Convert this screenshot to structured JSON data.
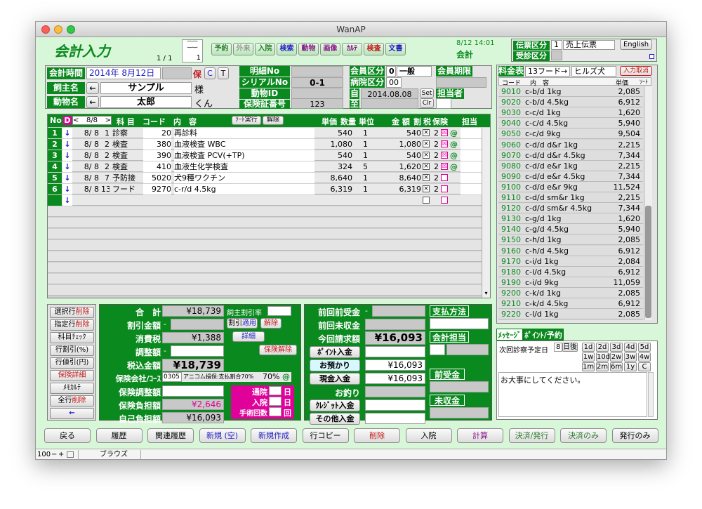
{
  "window": {
    "title": "WanAP"
  },
  "header": {
    "title": "会計入力",
    "page": "1 / 1",
    "counter": "1",
    "tabs": [
      {
        "label": "予約",
        "color": "#2a7a2a"
      },
      {
        "label": "外来",
        "color": "#999999"
      },
      {
        "label": "入院",
        "color": "#2a7a2a"
      },
      {
        "label": "検索",
        "color": "#2020c0"
      },
      {
        "label": "動物",
        "color": "#8a1a8a"
      },
      {
        "label": "画像",
        "color": "#8a1a8a"
      },
      {
        "label": "ｶﾙﾃ",
        "color": "#8a1a8a"
      },
      {
        "label": "検査",
        "color": "#c01a1a"
      },
      {
        "label": "文書",
        "color": "#2020c0"
      }
    ],
    "datetime": "8/12 14:01",
    "mode": "会計",
    "slip_label": "伝票区分",
    "slip_num": "1",
    "slip_value": "売上伝票",
    "reception_label": "受診区分",
    "english_button": "English"
  },
  "info": {
    "time_label": "会計時間",
    "date": "2014年 8月12日",
    "badge_ho": "保",
    "badge_c": "C",
    "badge_t": "T",
    "owner_label": "飼主名",
    "owner_arrow": "←",
    "owner_name": "サンプル",
    "owner_suffix": "様",
    "pet_label": "動物名",
    "pet_arrow": "←",
    "pet_name": "太郎",
    "pet_suffix": "くん",
    "detail_no_label": "明細No",
    "serial_label": "シリアルNo",
    "serial_value": "0-1",
    "animal_id_label": "動物ID",
    "insurance_no_label": "保険証番号",
    "insurance_no": "123",
    "member_label": "会員区分",
    "member_num": "0",
    "member_value": "一般",
    "member_expiry_label": "会員期限",
    "hospital_label": "病院区分",
    "hospital_value": "00",
    "from_label": "自",
    "from_date": "2014.08.08",
    "set_button": "Set",
    "to_label": "至",
    "clr_button": "Clr",
    "staff_label": "担当者"
  },
  "detail_table": {
    "headers": {
      "no": "No",
      "d": "D",
      "date_nav": "8/8",
      "subject": "科 目",
      "code": "コード",
      "content": "内　容",
      "sort_button": "ｿｰﾄ実行",
      "cancel_button": "解除",
      "unit_price": "単価",
      "qty": "数量",
      "unit": "単位",
      "amount": "金 額",
      "discount": "割",
      "tax": "税",
      "insurance": "保険",
      "person": "担当"
    },
    "rows": [
      {
        "no": "1",
        "date": "8/ 8",
        "subj_no": "1",
        "subject": "診察",
        "code": "20",
        "content": "再診料",
        "price": "540",
        "qty": "1",
        "amount": "540",
        "tax": "2",
        "ins": "☒",
        "at": "@"
      },
      {
        "no": "2",
        "date": "8/ 8",
        "subj_no": "2",
        "subject": "検査",
        "code": "380",
        "content": "血液検査 WBC",
        "price": "1,080",
        "qty": "1",
        "amount": "1,080",
        "tax": "2",
        "ins": "☒",
        "at": "@"
      },
      {
        "no": "3",
        "date": "8/ 8",
        "subj_no": "2",
        "subject": "検査",
        "code": "390",
        "content": "血液検査 PCV(+TP)",
        "price": "540",
        "qty": "1",
        "amount": "540",
        "tax": "2",
        "ins": "☒",
        "at": "@"
      },
      {
        "no": "4",
        "date": "8/ 8",
        "subj_no": "2",
        "subject": "検査",
        "code": "410",
        "content": "血液生化学検査",
        "price": "324",
        "qty": "5",
        "amount": "1,620",
        "tax": "2",
        "ins": "☒",
        "at": "@"
      },
      {
        "no": "5",
        "date": "8/ 8",
        "subj_no": "7",
        "subject": "予防接",
        "code": "5020",
        "content": "犬9種ワクチン",
        "price": "8,640",
        "qty": "1",
        "amount": "8,640",
        "tax": "2",
        "ins": "",
        "at": ""
      },
      {
        "no": "6",
        "date": "8/ 8",
        "subj_no": "13",
        "subject": "フード",
        "code": "9270",
        "content": "c-r/d 4.5kg",
        "price": "6,319",
        "qty": "1",
        "amount": "6,319",
        "tax": "2",
        "ins": "",
        "at": ""
      }
    ],
    "down_arrow": "↓"
  },
  "price_table": {
    "label": "料金表",
    "selector": "13フード→",
    "category": "ヒルズ犬",
    "cancel_input": "入力取消",
    "headers": {
      "code": "コード",
      "content": "内　容",
      "price": "単価",
      "sort": "ｿｰﾄ"
    },
    "rows": [
      {
        "code": "9010",
        "content": "c-b/d 1kg",
        "price": "2,085"
      },
      {
        "code": "9020",
        "content": "c-b/d 4.5kg",
        "price": "6,912"
      },
      {
        "code": "9030",
        "content": "c-c/d 1kg",
        "price": "1,620"
      },
      {
        "code": "9040",
        "content": "c-c/d 4.5kg",
        "price": "5,940"
      },
      {
        "code": "9050",
        "content": "c-c/d 9kg",
        "price": "9,504"
      },
      {
        "code": "9060",
        "content": "c-d/d d&r 1kg",
        "price": "2,215"
      },
      {
        "code": "9070",
        "content": "c-d/d d&r 4.5kg",
        "price": "7,344"
      },
      {
        "code": "9080",
        "content": "c-d/d e&r 1kg",
        "price": "2,215"
      },
      {
        "code": "9090",
        "content": "c-d/d e&r 4.5kg",
        "price": "7,344"
      },
      {
        "code": "9100",
        "content": "c-d/d e&r 9kg",
        "price": "11,524"
      },
      {
        "code": "9110",
        "content": "c-d/d sm&r 1kg",
        "price": "2,215"
      },
      {
        "code": "9120",
        "content": "c-d/d sm&r 4.5kg",
        "price": "7,344"
      },
      {
        "code": "9130",
        "content": "c-g/d 1kg",
        "price": "1,620"
      },
      {
        "code": "9140",
        "content": "c-g/d 4.5kg",
        "price": "5,940"
      },
      {
        "code": "9150",
        "content": "c-h/d 1kg",
        "price": "2,085"
      },
      {
        "code": "9160",
        "content": "c-h/d 4.5kg",
        "price": "6,912"
      },
      {
        "code": "9170",
        "content": "c-i/d 1kg",
        "price": "2,084"
      },
      {
        "code": "9180",
        "content": "c-i/d 4.5kg",
        "price": "6,912"
      },
      {
        "code": "9190",
        "content": "c-i/d 9kg",
        "price": "11,059"
      },
      {
        "code": "9200",
        "content": "c-k/d 1kg",
        "price": "2,085"
      },
      {
        "code": "9210",
        "content": "c-k/d 4.5kg",
        "price": "6,912"
      },
      {
        "code": "9220",
        "content": "c-l/d 1kg",
        "price": "2,085"
      }
    ]
  },
  "left_buttons": [
    {
      "label": "選択行",
      "red": "削除"
    },
    {
      "label": "指定行",
      "red": "削除"
    },
    {
      "label": "科目ﾁｪｯｸ",
      "red": ""
    },
    {
      "label": "行割引(%)",
      "red": ""
    },
    {
      "label": "行値引(円)",
      "red": ""
    },
    {
      "label": "",
      "red": "保険詳細"
    },
    {
      "label": "ﾒﾓｶﾙﾃ",
      "red": ""
    },
    {
      "label": "全行",
      "red": "削除"
    },
    {
      "label": "←",
      "red": ""
    }
  ],
  "totals": {
    "total_label": "合　計",
    "total": "¥18,739",
    "owner_discount_label": "飼主割引率",
    "discount_label": "割引金額",
    "discount_dash": "-",
    "discount_apply_a": "割引",
    "discount_apply_b": "適用",
    "discount_cancel": "解除",
    "tax_label": "消費税",
    "tax": "¥1,388",
    "detail_button": "詳細",
    "adjust_label": "調整額",
    "adjust_dash": "-",
    "insurance_cancel": "保険解除",
    "incl_tax_label": "税込金額",
    "incl_tax": "¥18,739",
    "ins_company_label": "保険会社/ｺｰｽ",
    "ins_code": "0305",
    "ins_name": "アニコム損保:支払割合70%",
    "ins_rate": "70%",
    "ins_at": "@",
    "ins_adjust_label": "保険調整額",
    "ins_burden_label": "保険負担額",
    "ins_burden": "¥2,646",
    "self_burden_label": "自己負担額",
    "self_burden": "¥16,093",
    "visit_label": "通院",
    "visit_unit": "日",
    "admit_label": "入院",
    "admit_unit": "日",
    "surgery_label": "手術回数",
    "surgery_unit": "回"
  },
  "payment": {
    "prev_advance_label": "前回前受金",
    "prev_advance_dash": "-",
    "prev_unpaid_label": "前回未収金",
    "this_bill_label": "今回請求額",
    "this_bill": "¥16,093",
    "point_label": "ﾎﾟｲﾝﾄ入金",
    "deposit_label": "お預かり",
    "deposit": "¥16,093",
    "cash_label": "現金入金",
    "cash": "¥16,093",
    "change_label": "お釣り",
    "credit_label": "ｸﾚｼﾞｯﾄ入金",
    "other_label": "その他入金",
    "method_label": "支払方法",
    "staff_label": "会計担当",
    "advance_label": "前受金",
    "unpaid_label": "未収金"
  },
  "message": {
    "tab_message": "ﾒｯｾｰｼﾞ",
    "tab_point": "ﾎﾟｲﾝﾄ/予約",
    "next_visit_label": "次回診察予定日",
    "days_value": "8",
    "days_after": "日後",
    "quick_row1": [
      "1d",
      "2d",
      "3d",
      "4d",
      "5d"
    ],
    "quick_row2": [
      "1w",
      "10d",
      "2w",
      "3w",
      "4w"
    ],
    "quick_row3": [
      "1m",
      "2m",
      "6m",
      "1y",
      "C"
    ],
    "text": "お大事にしてください。"
  },
  "bottom_buttons": [
    {
      "label": "戻る",
      "color": "#000000"
    },
    {
      "label": "履歴",
      "color": "#000000"
    },
    {
      "label": "関連履歴",
      "color": "#000000"
    },
    {
      "label": "新規 (空)",
      "color": "#2020c0"
    },
    {
      "label": "新規作成",
      "color": "#2020c0"
    },
    {
      "label": "行コピー",
      "color": "#000000"
    },
    {
      "label": "削除",
      "color": "#c01a1a"
    },
    {
      "label": "入院",
      "color": "#000000"
    },
    {
      "label": "計算",
      "color": "#8a1a8a"
    },
    {
      "label": "決済/発行",
      "color": "#2a7a2a"
    },
    {
      "label": "決済のみ",
      "color": "#2a7a2a"
    },
    {
      "label": "発行のみ",
      "color": "#000000"
    }
  ],
  "statusbar": {
    "zoom": "100",
    "mode": "ブラウズ"
  },
  "colors": {
    "accent_green": "#0a8a1e",
    "background": "#d8f7d8",
    "magenta": "#e0009a"
  }
}
